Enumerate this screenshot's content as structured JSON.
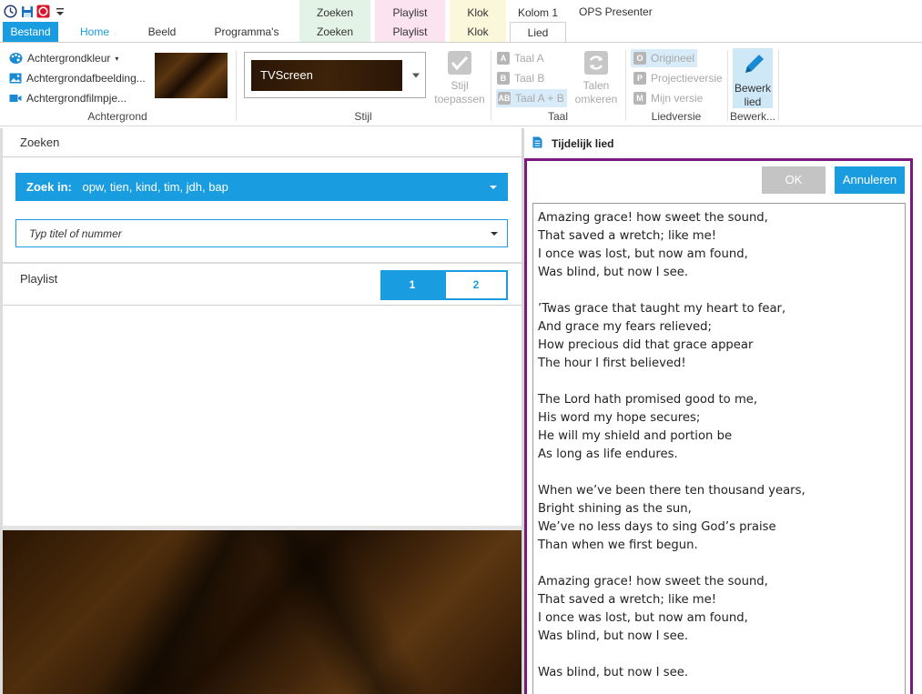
{
  "title_bar": {
    "app_title": "OPS Presenter",
    "context_headers": [
      {
        "label": "Zoeken",
        "color": "#e3f3e6"
      },
      {
        "label": "Playlist",
        "color": "#fbe3ef"
      },
      {
        "label": "Klok",
        "color": "#fbf7da"
      },
      {
        "label": "Kolom 1",
        "color": "#ffffff"
      }
    ],
    "qat_icons": [
      "clock-icon",
      "save-icon",
      "stop-icon",
      "customize-icon"
    ]
  },
  "tabs": {
    "file": "Bestand",
    "home": "Home",
    "beeld": "Beeld",
    "programmas": "Programma's",
    "zoeken": "Zoeken",
    "playlist": "Playlist",
    "klok": "Klok",
    "lied": "Lied"
  },
  "ribbon": {
    "achtergrond": {
      "label": "Achtergrond",
      "kleur": "Achtergrondkleur",
      "afbeelding": "Achtergrondafbeelding...",
      "filmpje": "Achtergrondfilmpje..."
    },
    "stijl": {
      "label": "Stijl",
      "selected": "TVScreen",
      "apply_line1": "Stijl",
      "apply_line2": "toepassen"
    },
    "taal": {
      "label": "Taal",
      "a": "Taal A",
      "b": "Taal B",
      "ab": "Taal A + B",
      "swap_line1": "Talen",
      "swap_line2": "omkeren"
    },
    "liedversie": {
      "label": "Liedversie",
      "origineel": "Origineel",
      "projectie": "Projectieversie",
      "mijn": "Mijn versie"
    },
    "bewerken": {
      "label": "Bewerk...",
      "edit_line1": "Bewerk",
      "edit_line2": "lied"
    }
  },
  "left_panel": {
    "search_title": "Zoeken",
    "zoek_in_label": "Zoek in:",
    "zoek_in_value": "opw, tien, kind, tim, jdh, bap",
    "search_placeholder": "Typ titel of nummer",
    "playlist_title": "Playlist",
    "playlist_tabs": [
      "1",
      "2"
    ]
  },
  "right_panel": {
    "title": "Tijdelijk lied",
    "ok": "OK",
    "cancel": "Annuleren",
    "lyrics": "Amazing grace! how sweet the sound,\nThat saved a wretch; like me!\nI once was lost, but now am found,\nWas blind, but now I see.\n\n’Twas grace that taught my heart to fear,\nAnd grace my fears relieved;\nHow precious did that grace appear\nThe hour I first believed!\n\nThe Lord hath promised good to me,\nHis word my hope secures;\nHe will my shield and portion be\nAs long as life endures.\n\nWhen we’ve been there ten thousand years,\nBright shining as the sun,\nWe’ve no less days to sing God’s praise\nThan when we first begun.\n\nAmazing grace! how sweet the sound,\nThat saved a wretch; like me!\nI once was lost, but now am found,\nWas blind, but now I see.\n\nWas blind, but now I see."
  },
  "colors": {
    "accent": "#1a9de0",
    "editor_border": "#7b1a7e",
    "ok_disabled": "#c4c4c4"
  }
}
